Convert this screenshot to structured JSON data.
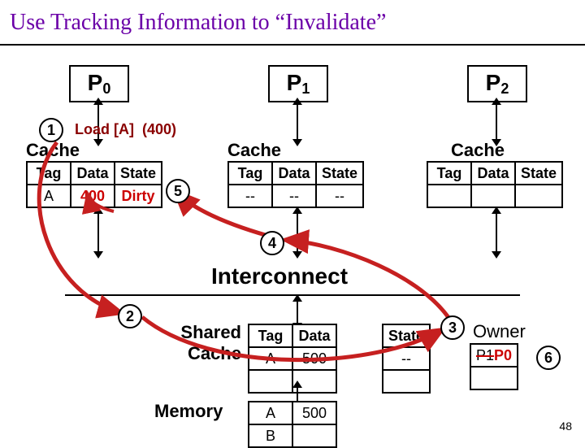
{
  "title": "Use Tracking Information to “Invalidate”",
  "slide_number": "48",
  "processors": {
    "p0": "P",
    "p0s": "0",
    "p1": "P",
    "p1s": "1",
    "p2": "P",
    "p2s": "2"
  },
  "load": {
    "text": "Load [A]",
    "result": "(400)"
  },
  "cache_hdr": {
    "tag": "Tag",
    "data": "Data",
    "state": "State"
  },
  "cache_word": "Cache",
  "p0_row": {
    "tag": "A",
    "data": "400",
    "state": "Dirty"
  },
  "p1_row": {
    "tag": "--",
    "data": "--",
    "state": "--"
  },
  "interconnect": "Interconnect",
  "shared": {
    "label1": "Shared",
    "label2": "Cache"
  },
  "shared_row": {
    "tag": "A",
    "data": "500",
    "state": "--"
  },
  "owner": {
    "label": "Owner",
    "old": "P1",
    "new": "P0"
  },
  "memory": {
    "label": "Memory",
    "a": "A",
    "b": "B",
    "av": "500"
  },
  "badges": {
    "b1": "1",
    "b2": "2",
    "b3": "3",
    "b4": "4",
    "b5": "5",
    "b6": "6"
  }
}
